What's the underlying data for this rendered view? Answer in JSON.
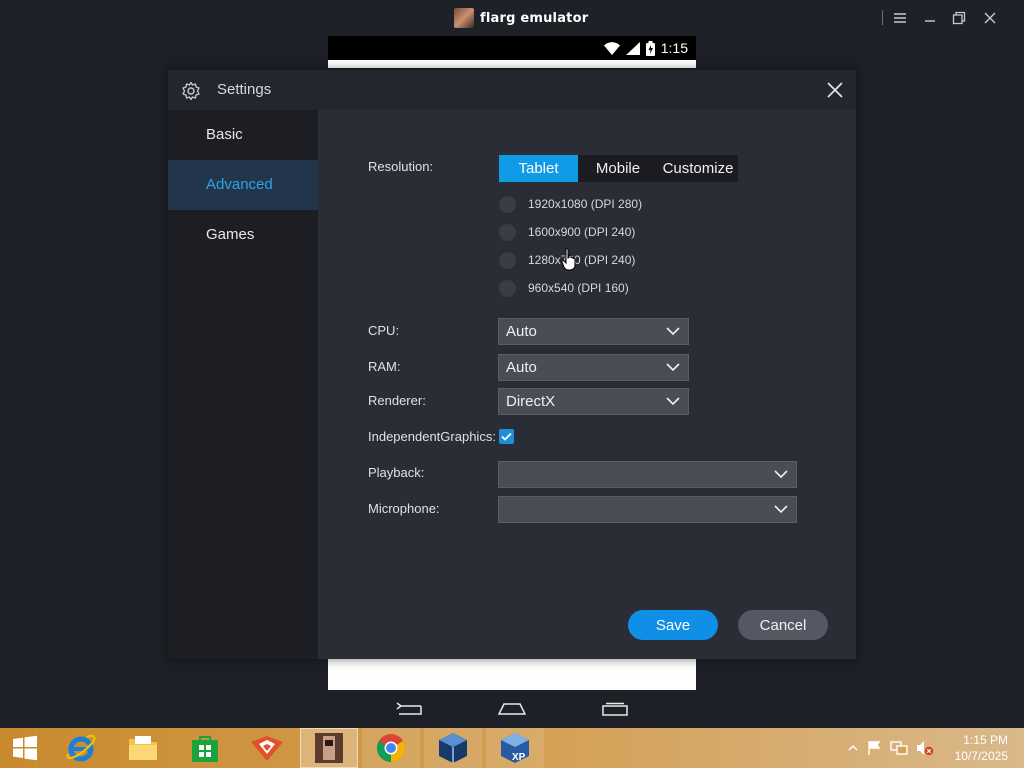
{
  "window": {
    "title": "flarg emulator"
  },
  "android": {
    "status_time": "1:15"
  },
  "dialog": {
    "title": "Settings",
    "sidebar": [
      {
        "label": "Basic"
      },
      {
        "label": "Advanced"
      },
      {
        "label": "Games"
      }
    ],
    "resolution": {
      "label": "Resolution:",
      "tabs": [
        "Tablet",
        "Mobile",
        "Customize"
      ],
      "selected_tab": "Tablet",
      "options": [
        "1920x1080 (DPI 280)",
        "1600x900 (DPI 240)",
        "1280x720 (DPI 240)",
        "960x540 (DPI 160)"
      ]
    },
    "cpu": {
      "label": "CPU:",
      "value": "Auto"
    },
    "ram": {
      "label": "RAM:",
      "value": "Auto"
    },
    "renderer": {
      "label": "Renderer:",
      "value": "DirectX"
    },
    "independent_graphics": {
      "label": "IndependentGraphics:",
      "checked": true
    },
    "playback": {
      "label": "Playback:",
      "value": ""
    },
    "microphone": {
      "label": "Microphone:",
      "value": ""
    },
    "save_label": "Save",
    "cancel_label": "Cancel"
  },
  "taskbar": {
    "items": [
      "windows-start",
      "internet-explorer",
      "file-explorer",
      "store",
      "fox-app",
      "flarg-emulator",
      "chrome",
      "virtualbox",
      "virtualbox-xp"
    ],
    "time": "1:15 PM",
    "date": "10/7/2025"
  },
  "colors": {
    "accent": "#0f9be6",
    "active_nav": "#2ea3e8"
  }
}
